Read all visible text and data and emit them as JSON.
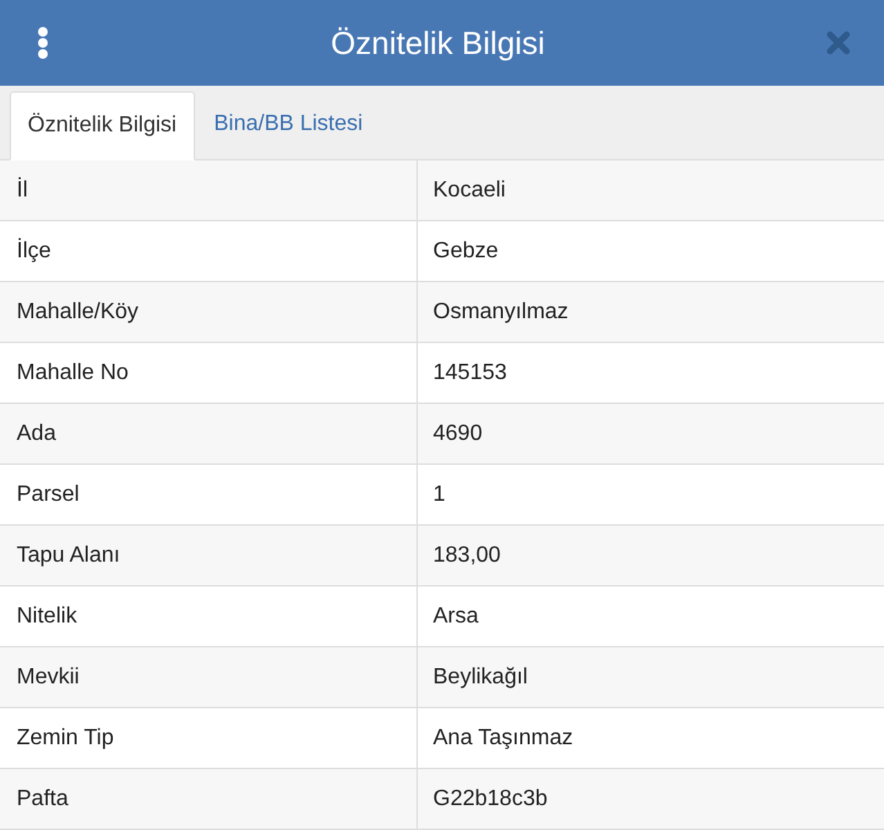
{
  "header": {
    "title": "Öznitelik Bilgisi"
  },
  "tabs": [
    {
      "label": "Öznitelik Bilgisi",
      "selected": true
    },
    {
      "label": "Bina/BB Listesi",
      "selected": false
    }
  ],
  "table": {
    "rows": [
      {
        "label": "İl",
        "value": "Kocaeli"
      },
      {
        "label": "İlçe",
        "value": "Gebze"
      },
      {
        "label": "Mahalle/Köy",
        "value": "Osmanyılmaz"
      },
      {
        "label": "Mahalle No",
        "value": "145153"
      },
      {
        "label": "Ada",
        "value": "4690"
      },
      {
        "label": "Parsel",
        "value": "1"
      },
      {
        "label": "Tapu Alanı",
        "value": "183,00"
      },
      {
        "label": "Nitelik",
        "value": "Arsa"
      },
      {
        "label": "Mevkii",
        "value": "Beylikağıl"
      },
      {
        "label": "Zemin Tip",
        "value": "Ana Taşınmaz"
      },
      {
        "label": "Pafta",
        "value": "G22b18c3b"
      }
    ]
  }
}
